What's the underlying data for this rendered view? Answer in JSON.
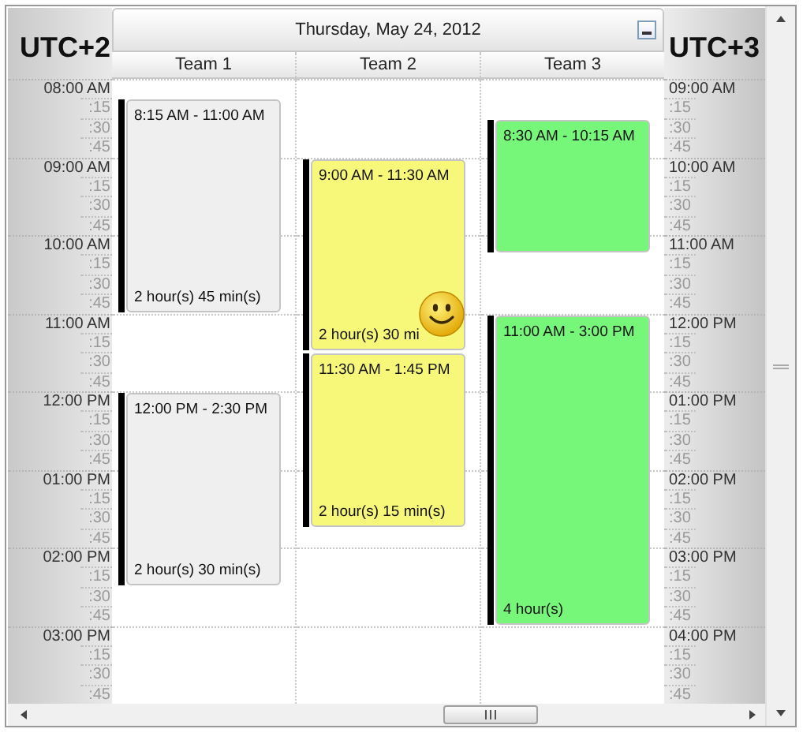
{
  "header": {
    "date": "Thursday, May 24, 2012"
  },
  "left_zone": {
    "label": "UTC+2",
    "hours": [
      {
        "hour": "08:00 AM",
        "quarters": [
          ":15",
          ":30",
          ":45"
        ]
      },
      {
        "hour": "09:00 AM",
        "quarters": [
          ":15",
          ":30",
          ":45"
        ]
      },
      {
        "hour": "10:00 AM",
        "quarters": [
          ":15",
          ":30",
          ":45"
        ]
      },
      {
        "hour": "11:00 AM",
        "quarters": [
          ":15",
          ":30",
          ":45"
        ]
      },
      {
        "hour": "12:00 PM",
        "quarters": [
          ":15",
          ":30",
          ":45"
        ]
      },
      {
        "hour": "01:00 PM",
        "quarters": [
          ":15",
          ":30",
          ":45"
        ]
      },
      {
        "hour": "02:00 PM",
        "quarters": [
          ":15",
          ":30",
          ":45"
        ]
      },
      {
        "hour": "03:00 PM",
        "quarters": [
          ":15",
          ":30",
          ":45"
        ]
      }
    ]
  },
  "right_zone": {
    "label": "UTC+3",
    "hours": [
      {
        "hour": "09:00 AM",
        "quarters": [
          ":15",
          ":30",
          ":45"
        ]
      },
      {
        "hour": "10:00 AM",
        "quarters": [
          ":15",
          ":30",
          ":45"
        ]
      },
      {
        "hour": "11:00 AM",
        "quarters": [
          ":15",
          ":30",
          ":45"
        ]
      },
      {
        "hour": "12:00 PM",
        "quarters": [
          ":15",
          ":30",
          ":45"
        ]
      },
      {
        "hour": "01:00 PM",
        "quarters": [
          ":15",
          ":30",
          ":45"
        ]
      },
      {
        "hour": "02:00 PM",
        "quarters": [
          ":15",
          ":30",
          ":45"
        ]
      },
      {
        "hour": "03:00 PM",
        "quarters": [
          ":15",
          ":30",
          ":45"
        ]
      },
      {
        "hour": "04:00 PM",
        "quarters": [
          ":15",
          ":30",
          ":45"
        ]
      }
    ]
  },
  "teams": [
    {
      "name": "Team 1",
      "events": [
        {
          "time": "8:15 AM - 11:00 AM",
          "duration": "2 hour(s) 45 min(s)",
          "color": "#efefef"
        },
        {
          "time": "12:00 PM - 2:30 PM",
          "duration": "2 hour(s) 30 min(s)",
          "color": "#efefef"
        }
      ]
    },
    {
      "name": "Team 2",
      "events": [
        {
          "time": "9:00 AM - 11:30 AM",
          "duration": "2 hour(s) 30 mi",
          "color": "#f7f77a"
        },
        {
          "time": "11:30 AM - 1:45 PM",
          "duration": "2 hour(s) 15 min(s)",
          "color": "#f7f77a"
        }
      ]
    },
    {
      "name": "Team 3",
      "events": [
        {
          "time": "8:30 AM - 10:15 AM",
          "color": "#77f77a"
        },
        {
          "time": "11:00 AM - 3:00 PM",
          "duration": "4 hour(s)",
          "color": "#77f77a"
        }
      ]
    }
  ]
}
